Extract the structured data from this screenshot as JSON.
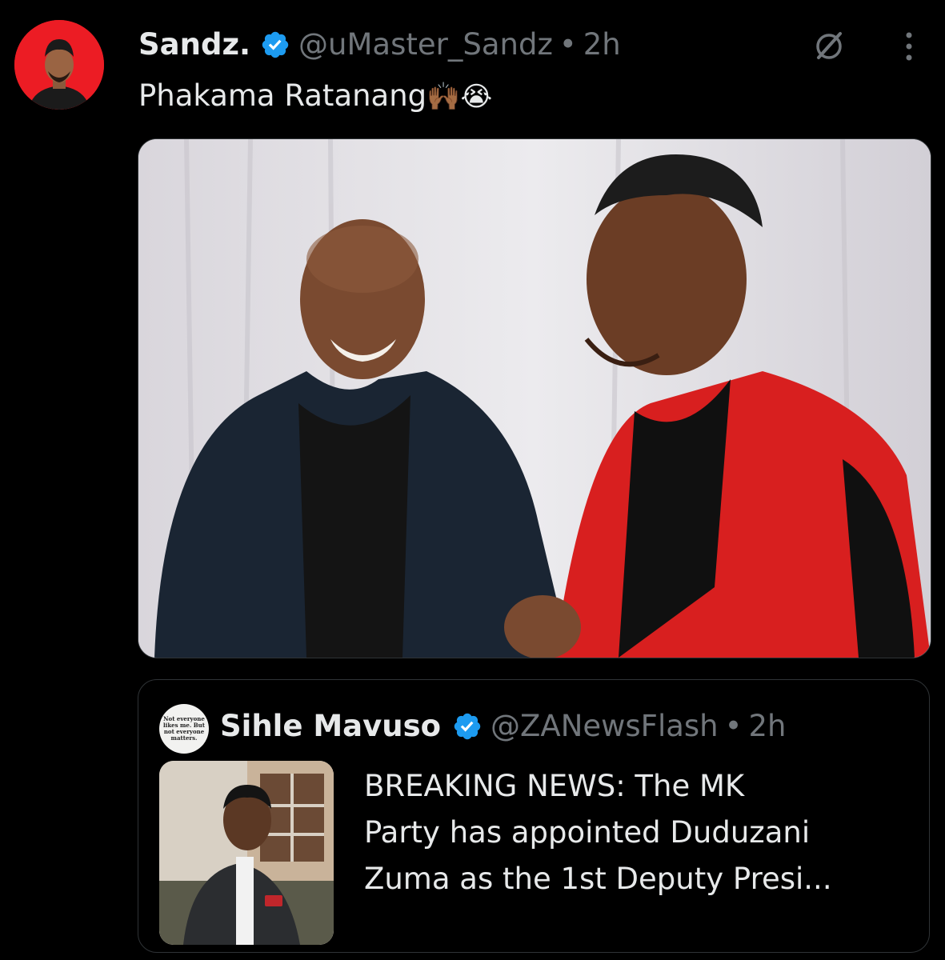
{
  "tweet": {
    "author": {
      "display_name": "Sandz.",
      "handle": "@uMaster_Sandz",
      "verified": true,
      "avatar_bg": "#ec1c24"
    },
    "separator": "•",
    "time": "2h",
    "text": "Phakama Ratanang",
    "text_emojis": "🙌🏾😭",
    "actions": {
      "grok_icon": "grok-icon",
      "more_icon": "more-icon"
    },
    "media": {
      "description_icon": "photo-two-men"
    }
  },
  "quote": {
    "author": {
      "display_name": "Sihle Mavuso",
      "handle": "@ZANewsFlash",
      "verified": true,
      "avatar_lines": [
        "Not everyone",
        "likes me. But",
        "not everyone",
        "matters."
      ]
    },
    "separator": "•",
    "time": "2h",
    "text_lines": [
      "BREAKING NEWS: The MK",
      "Party has appointed Duduzani",
      "Zuma as the 1st Deputy Presi..."
    ]
  },
  "colors": {
    "background": "#000000",
    "text_primary": "#e7e9ea",
    "text_secondary": "#71767b",
    "verified_blue": "#1d9bf0",
    "border": "#2f3336"
  }
}
